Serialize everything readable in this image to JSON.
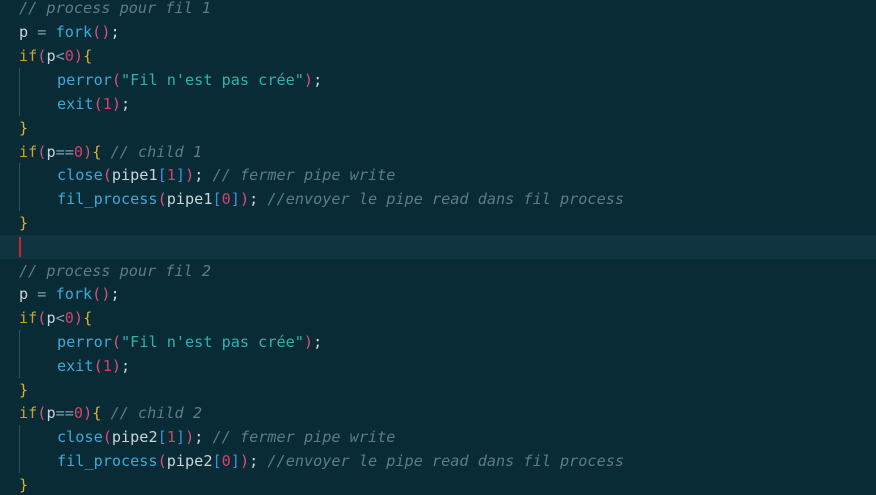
{
  "editor": {
    "language": "C",
    "block1": {
      "comment_header": "// process pour fil 1",
      "fork_var": "p",
      "fork_eq": " = ",
      "fork_fn": "fork",
      "if_kw": "if",
      "err_var": "p",
      "lt": "<",
      "zero": "0",
      "perror_fn": "perror",
      "perror_msg": "\"Fil n'est pas crée\"",
      "exit_fn": "exit",
      "exit_code": "1",
      "if2_kw": "if",
      "child_var": "p",
      "eqeq": "==",
      "zero2": "0",
      "child_comment": "// child 1",
      "close_fn": "close",
      "close_arg": "pipe1",
      "close_idx": "1",
      "close_comment": "// fermer pipe write",
      "fp_fn": "fil_process",
      "fp_arg": "pipe1",
      "fp_idx": "0",
      "fp_comment": "//envoyer le pipe read dans fil process"
    },
    "block2": {
      "comment_header": "// process pour fil 2",
      "fork_var": "p",
      "fork_eq": " = ",
      "fork_fn": "fork",
      "if_kw": "if",
      "err_var": "p",
      "lt": "<",
      "zero": "0",
      "perror_fn": "perror",
      "perror_msg": "\"Fil n'est pas crée\"",
      "exit_fn": "exit",
      "exit_code": "1",
      "if2_kw": "if",
      "child_var": "p",
      "eqeq": "==",
      "zero2": "0",
      "child_comment": "// child 2",
      "close_fn": "close",
      "close_arg": "pipe2",
      "close_idx": "1",
      "close_comment": "// fermer pipe write",
      "fp_fn": "fil_process",
      "fp_arg": "pipe2",
      "fp_idx": "0",
      "fp_comment": "//envoyer le pipe read dans fil process"
    }
  },
  "colors": {
    "background": "#082b36",
    "current_line": "#0e3540",
    "cursor": "#d4202c",
    "comment": "#5c7c88",
    "keyword": "#c7a233",
    "function": "#3fa8d6",
    "number": "#d3406c",
    "string": "#2fb3ae"
  }
}
